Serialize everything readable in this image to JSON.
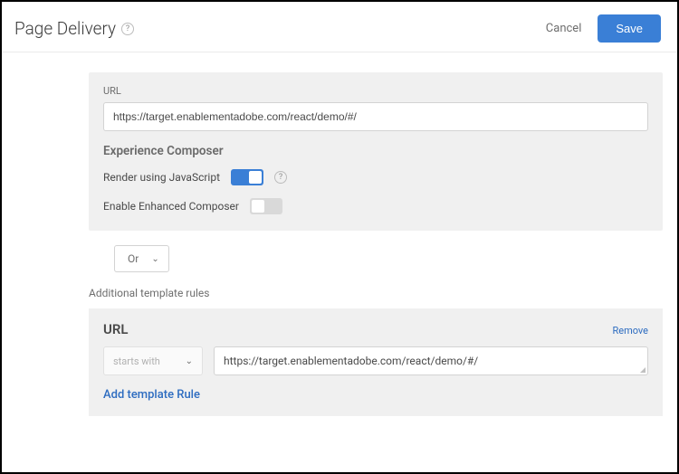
{
  "header": {
    "title": "Page Delivery",
    "cancel": "Cancel",
    "save": "Save"
  },
  "urlSection": {
    "label": "URL",
    "value": "https://target.enablementadobe.com/react/demo/#/"
  },
  "composer": {
    "heading": "Experience Composer",
    "renderJsLabel": "Render using JavaScript",
    "renderJsOn": true,
    "enhancedLabel": "Enable Enhanced Composer",
    "enhancedOn": false
  },
  "logic": {
    "operator": "Or"
  },
  "additional": {
    "label": "Additional template rules",
    "rule": {
      "title": "URL",
      "removeLabel": "Remove",
      "operator": "starts with",
      "value": "https://target.enablementadobe.com/react/demo/#/"
    },
    "addLabel": "Add template Rule"
  }
}
